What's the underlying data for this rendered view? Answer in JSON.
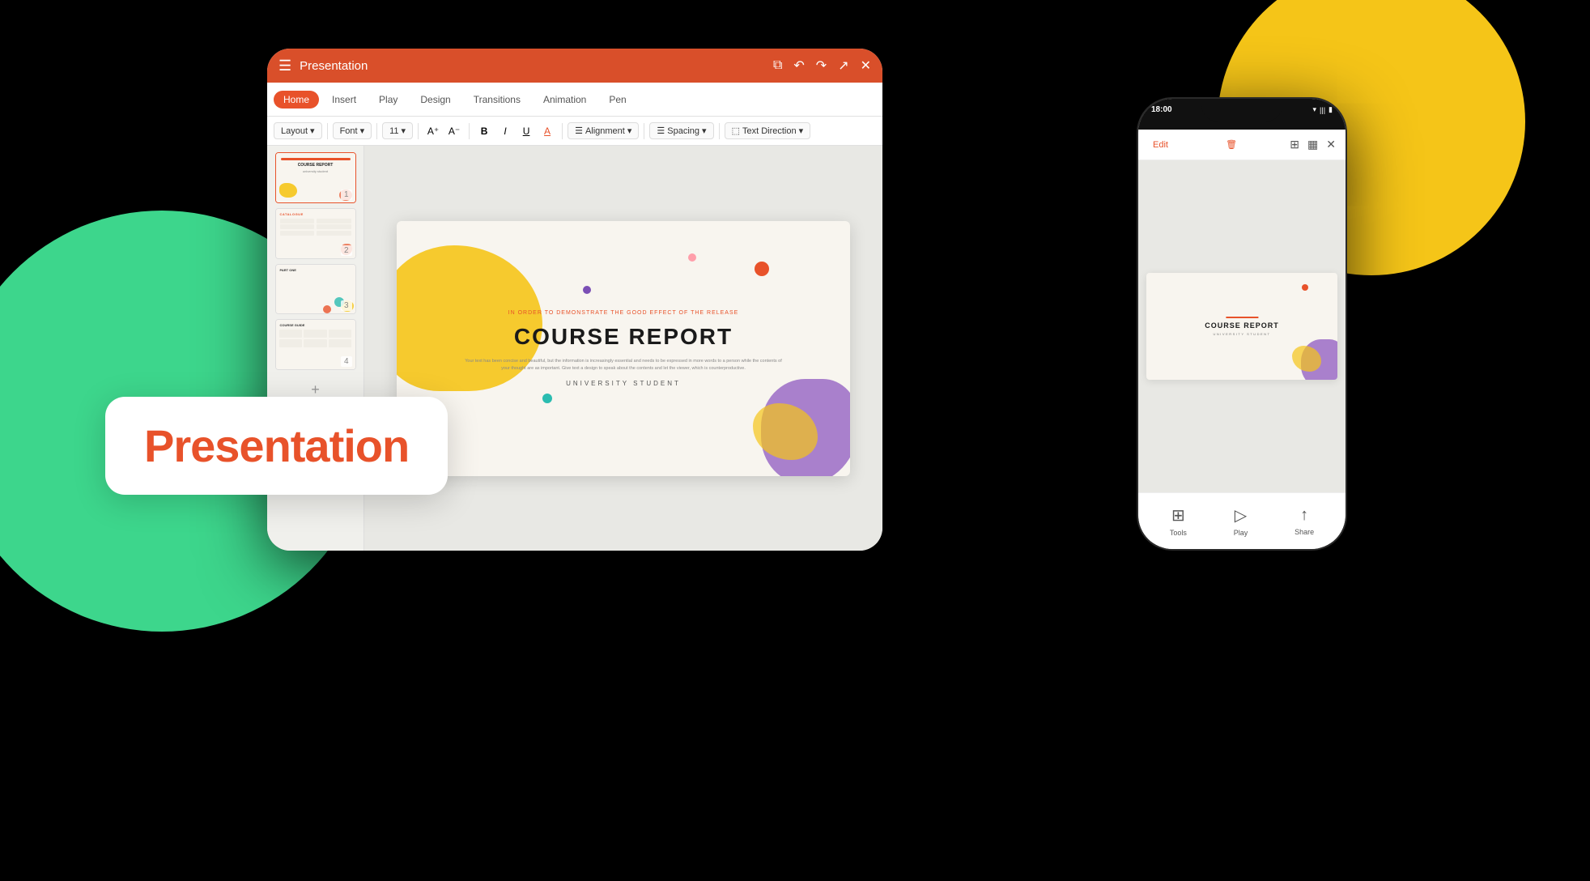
{
  "app": {
    "title": "Presentation",
    "brand_color": "#E8522A",
    "green_circle_color": "#3DD68C",
    "yellow_circle_color": "#F5C518"
  },
  "label": {
    "text": "Presentation"
  },
  "tablet": {
    "titlebar": {
      "title": "Presentation",
      "menu_icon": "☰"
    },
    "tabs": [
      {
        "label": "Home",
        "active": true
      },
      {
        "label": "Insert"
      },
      {
        "label": "Play"
      },
      {
        "label": "Design"
      },
      {
        "label": "Transitions"
      },
      {
        "label": "Animation"
      },
      {
        "label": "Pen"
      }
    ],
    "format_bar": {
      "layout_label": "Layout",
      "font_label": "Font",
      "font_size": "11",
      "bold": "B",
      "italic": "I",
      "underline": "U",
      "font_color": "A",
      "alignment_label": "Alignment",
      "spacing_label": "Spacing",
      "text_direction_label": "Text Direction"
    },
    "slides": [
      {
        "number": "1",
        "active": true
      },
      {
        "number": "2"
      },
      {
        "number": "3"
      },
      {
        "number": "4"
      }
    ],
    "add_slide_label": "+"
  },
  "slide": {
    "subtitle_small": "IN ORDER TO DEMONSTRATE THE\nGOOD EFFECT OF THE RELEASE",
    "main_title": "COURSE REPORT",
    "body_text": "Your text has been concise and beautiful, but the information is increasingly essential and needs to be expressed in more words to a person while the\ncontents of your thought are as important. Give text a design to speak about the contents and let the viewer, which is counterproductive.",
    "student_label": "UNIVERSITY STUDENT"
  },
  "phone": {
    "status": {
      "time": "18:00",
      "wifi": "▾",
      "signal": "|||",
      "battery": "▮▮▮"
    },
    "toolbar": {
      "edit_label": "Edit",
      "delete_icon": "🗑",
      "grid_icon": "⊞",
      "layout_icon": "▦",
      "close_icon": "✕"
    },
    "slide": {
      "orange_bar": true,
      "title": "COURSE REPORT",
      "student": "UNIVERSITY STUDENT"
    },
    "bottom_bar": {
      "tools_label": "Tools",
      "play_label": "Play",
      "share_label": "Share"
    }
  },
  "slide_thumbnails": [
    {
      "label": "COURSE REPORT",
      "sub": "university student"
    },
    {
      "label": "CATALOGUE"
    },
    {
      "label": "PART ONE"
    },
    {
      "label": "COURSE GUIDE"
    }
  ]
}
